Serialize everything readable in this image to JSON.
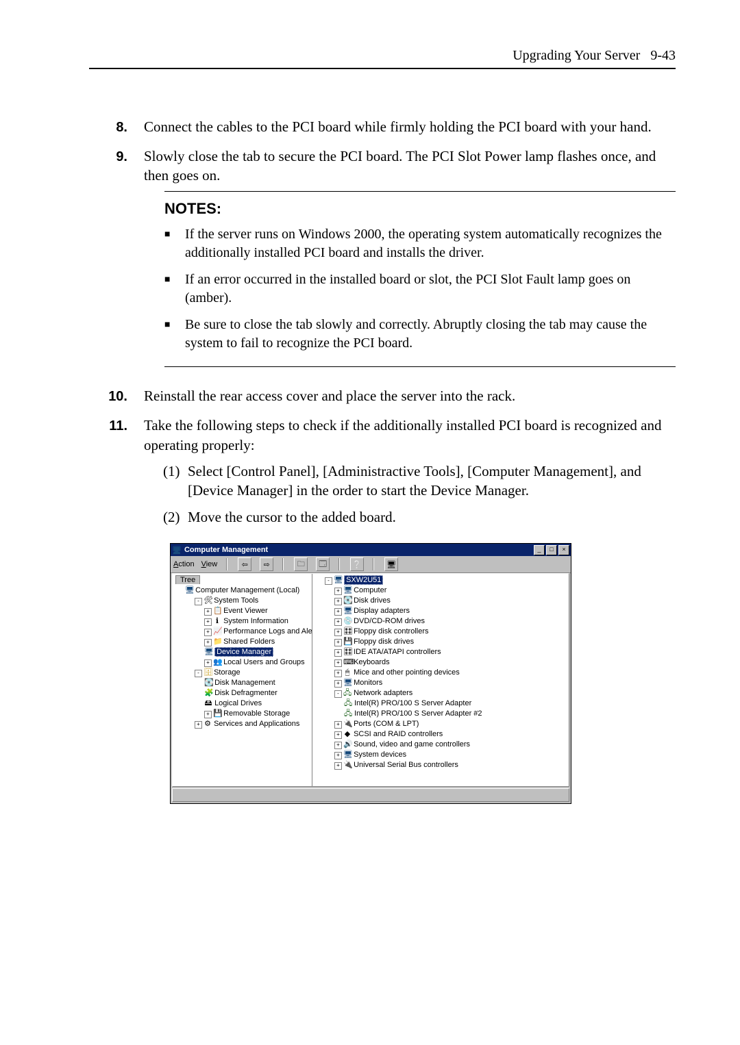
{
  "header": {
    "text": "Upgrading Your Server",
    "page": "9-43"
  },
  "steps": [
    {
      "n": "8.",
      "text": "Connect the cables to the PCI board while firmly holding the PCI board with your hand."
    },
    {
      "n": "9.",
      "text": "Slowly close the tab to secure the PCI board. The PCI Slot Power lamp flashes once, and then goes on."
    }
  ],
  "notes": {
    "title": "NOTES:",
    "items": [
      "If the server runs on Windows 2000, the operating system automatically recognizes the additionally installed PCI board and installs the driver.",
      "If an error occurred in the installed board or slot, the PCI Slot Fault lamp goes on (amber).",
      "Be sure to close the tab slowly and correctly.   Abruptly closing the tab may cause the system to fail to recognize the PCI board."
    ]
  },
  "steps2": [
    {
      "n": "10.",
      "text": "Reinstall the rear access cover and place the server into the rack."
    },
    {
      "n": "11.",
      "text": "Take the following steps to check if the additionally installed PCI board is recognized and operating properly:"
    }
  ],
  "substeps": [
    {
      "n": "(1)",
      "text": "Select [Control Panel], [Administractive Tools], [Computer Management], and [Device Manager] in the order to start the Device Manager."
    },
    {
      "n": "(2)",
      "text": "Move the cursor to the added board."
    }
  ],
  "screenshot": {
    "title": "Computer Management",
    "menu": {
      "action": "Action",
      "view": "View"
    },
    "tree_tab": "Tree",
    "left_root": "Computer Management (Local)",
    "left": {
      "system_tools": "System Tools",
      "event_viewer": "Event Viewer",
      "system_information": "System Information",
      "perf_logs": "Performance Logs and Alerts",
      "shared_folders": "Shared Folders",
      "device_manager": "Device Manager",
      "local_users": "Local Users and Groups",
      "storage": "Storage",
      "disk_management": "Disk Management",
      "disk_defrag": "Disk Defragmenter",
      "logical_drives": "Logical Drives",
      "removable_storage": "Removable Storage",
      "services_apps": "Services and Applications"
    },
    "right_root": "SXW2U51",
    "right": {
      "computer": "Computer",
      "disk_drives": "Disk drives",
      "display_adapters": "Display adapters",
      "dvd_cd": "DVD/CD-ROM drives",
      "floppy_ctrl": "Floppy disk controllers",
      "floppy_drives": "Floppy disk drives",
      "ide": "IDE ATA/ATAPI controllers",
      "keyboards": "Keyboards",
      "mice": "Mice and other pointing devices",
      "monitors": "Monitors",
      "network_adapters": "Network adapters",
      "nic1": "Intel(R) PRO/100 S Server Adapter",
      "nic2": "Intel(R) PRO/100 S Server Adapter #2",
      "ports": "Ports (COM & LPT)",
      "scsi": "SCSI and RAID controllers",
      "sound": "Sound, video and game controllers",
      "system_devices": "System devices",
      "usb": "Universal Serial Bus controllers"
    },
    "win_buttons": {
      "min": "_",
      "max": "□",
      "close": "×"
    }
  }
}
